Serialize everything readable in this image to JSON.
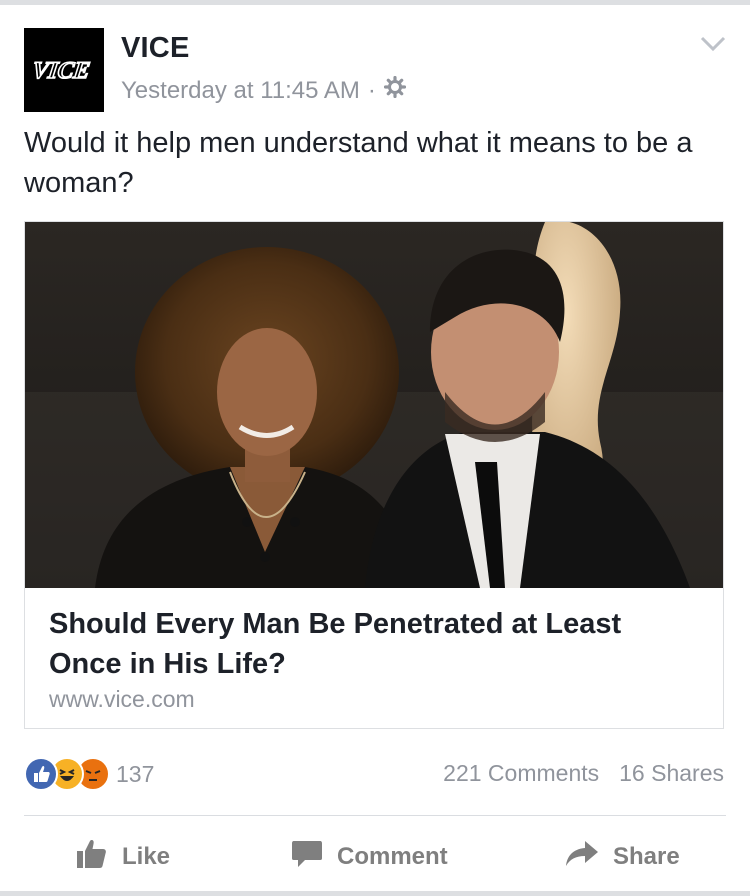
{
  "post": {
    "page_name": "VICE",
    "avatar_text": "VICE",
    "timestamp": "Yesterday at 11:45 AM",
    "separator": "·",
    "audience_icon": "gear-icon",
    "caption": "Would it help men understand what it means to be a woman?"
  },
  "link": {
    "title": "Should Every Man Be Penetrated at Least Once in His Life?",
    "domain": "www.vice.com"
  },
  "engagement": {
    "reaction_icons": [
      "like-icon",
      "haha-icon",
      "angry-icon"
    ],
    "reaction_count": "137",
    "comments": "221 Comments",
    "shares": "16 Shares"
  },
  "actions": {
    "like": "Like",
    "comment": "Comment",
    "share": "Share"
  },
  "colors": {
    "text": "#1d2129",
    "muted": "#90949c",
    "like_blue": "#4267b2",
    "reaction_yellow": "#f7b125",
    "reaction_red": "#e9710f"
  }
}
